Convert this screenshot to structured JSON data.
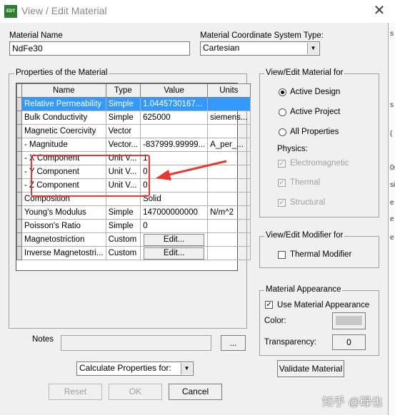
{
  "window": {
    "title": "View / Edit Material",
    "icon_text": "EDT",
    "close_glyph": "✕"
  },
  "material_name": {
    "label": "Material Name",
    "value": "NdFe30"
  },
  "coord_system": {
    "label": "Material Coordinate System Type:",
    "value": "Cartesian"
  },
  "properties": {
    "group_title": "Properties of the Material",
    "columns": [
      "Name",
      "Type",
      "Value",
      "Units"
    ],
    "rows": [
      {
        "name": "Relative Permeability",
        "type": "Simple",
        "value": "1.0445730167...",
        "units": ""
      },
      {
        "name": "Bulk Conductivity",
        "type": "Simple",
        "value": "625000",
        "units": "siemens..."
      },
      {
        "name": "Magnetic Coercivity",
        "type": "Vector",
        "value": "",
        "units": ""
      },
      {
        "name": "- Magnitude",
        "type": "Vector...",
        "value": "-837999.99999...",
        "units": "A_per_..."
      },
      {
        "name": "- X Component",
        "type": "Unit V...",
        "value": "1",
        "units": ""
      },
      {
        "name": "- Y Component",
        "type": "Unit V...",
        "value": "0",
        "units": ""
      },
      {
        "name": "- Z Component",
        "type": "Unit V...",
        "value": "0",
        "units": ""
      },
      {
        "name": "Composition",
        "type": "",
        "value": "Solid",
        "units": ""
      },
      {
        "name": "Young's Modulus",
        "type": "Simple",
        "value": "147000000000",
        "units": "N/m^2"
      },
      {
        "name": "Poisson's Ratio",
        "type": "Simple",
        "value": "0",
        "units": ""
      },
      {
        "name": "Magnetostriction",
        "type": "Custom",
        "value": "Edit...",
        "units": ""
      },
      {
        "name": "Inverse Magnetostri...",
        "type": "Custom",
        "value": "Edit...",
        "units": ""
      }
    ]
  },
  "view_edit_for": {
    "title": "View/Edit Material for",
    "options": [
      "Active Design",
      "Active Project",
      "All Properties"
    ],
    "selected": "Active Design",
    "physics_label": "Physics:",
    "physics": [
      "Electromagnetic",
      "Thermal",
      "Structural"
    ]
  },
  "modifier": {
    "title": "View/Edit Modifier for",
    "thermal_label": "Thermal Modifier"
  },
  "appearance": {
    "title": "Material Appearance",
    "use_label": "Use Material Appearance",
    "color_label": "Color:",
    "transparency_label": "Transparency:",
    "transparency_value": "0",
    "swatch_color": "#c8c8c8"
  },
  "notes": {
    "label": "Notes",
    "browse": "..."
  },
  "calculate": {
    "value": "Calculate Properties for:"
  },
  "buttons": {
    "validate": "Validate Material",
    "reset": "Reset",
    "ok": "OK",
    "cancel": "Cancel"
  },
  "watermark": "知乎 @碌也",
  "edge_fragments": [
    "s",
    "s",
    "(",
    "0s",
    "si",
    "e",
    "e",
    "e"
  ],
  "colors": {
    "selection": "#3399ff",
    "annotation": "#e53935"
  }
}
